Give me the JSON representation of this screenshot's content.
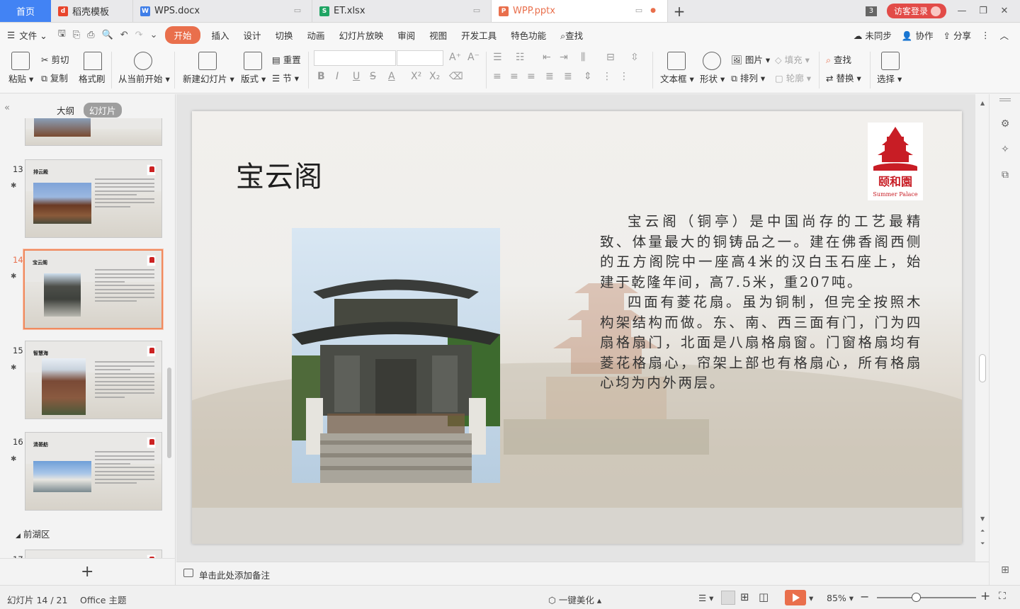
{
  "tabs": [
    {
      "label": "首页",
      "type": "home"
    },
    {
      "label": "稻壳模板",
      "icon": "docer-icon",
      "color": "#e8452c"
    },
    {
      "label": "WPS.docx",
      "icon": "writer-icon",
      "color": "#3f7ee8"
    },
    {
      "label": "ET.xlsx",
      "icon": "sheet-icon",
      "color": "#1fa463"
    },
    {
      "label": "WPP.pptx",
      "icon": "ppt-icon",
      "color": "#e96f4c",
      "active": true
    }
  ],
  "tabbar": {
    "window_count": "3",
    "login_label": "访客登录"
  },
  "menu": {
    "file": "文件",
    "items": [
      "开始",
      "插入",
      "设计",
      "切换",
      "动画",
      "幻灯片放映",
      "审阅",
      "视图",
      "开发工具",
      "特色功能"
    ],
    "active": "开始",
    "search": "查找",
    "sync": "未同步",
    "collab": "协作",
    "share": "分享"
  },
  "ribbon": {
    "paste": "粘贴",
    "cut": "剪切",
    "copy": "复制",
    "format_painter": "格式刷",
    "play_from_current": "从当前开始",
    "new_slide": "新建幻灯片",
    "layout": "版式",
    "reset": "重置",
    "section": "节",
    "textbox": "文本框",
    "shape": "形状",
    "picture": "图片",
    "arrange": "排列",
    "fill": "填充",
    "outline": "轮廓",
    "find": "查找",
    "replace": "替换",
    "select": "选择"
  },
  "left_panel": {
    "tab_outline": "大纲",
    "tab_slides": "幻灯片",
    "section_name": "前湖区",
    "slides": [
      {
        "num": "13",
        "title": "排云殿"
      },
      {
        "num": "14",
        "title": "宝云阁",
        "selected": true
      },
      {
        "num": "15",
        "title": "智慧海"
      },
      {
        "num": "16",
        "title": "清晏舫"
      },
      {
        "num": "17",
        "title": ""
      }
    ]
  },
  "slide": {
    "title": "宝云阁",
    "logo_text": "颐和園",
    "logo_subtext": "Summer Palace",
    "paragraphs": [
      "宝云阁（铜亭）是中国尚存的工艺最精致、体量最大的铜铸品之一。建在佛香阁西侧的五方阁院中一座高4米的汉白玉石座上，始建于乾隆年间，高7.5米，重207吨。",
      "四面有菱花扇。虽为铜制，但完全按照木构架结构而做。东、南、西三面有门，门为四扇格扇门，北面是八扇格扇窗。门窗格扇均有菱花格扇心，帘架上部也有格扇心，所有格扇心均为内外两层。"
    ]
  },
  "notes": {
    "placeholder": "单击此处添加备注"
  },
  "status": {
    "slide_counter": "幻灯片 14 / 21",
    "theme": "Office 主题",
    "beautify": "一键美化",
    "zoom": "85%"
  },
  "colors": {
    "accent": "#e96f4c",
    "home_tab": "#4283f4",
    "login": "#e24b48"
  }
}
